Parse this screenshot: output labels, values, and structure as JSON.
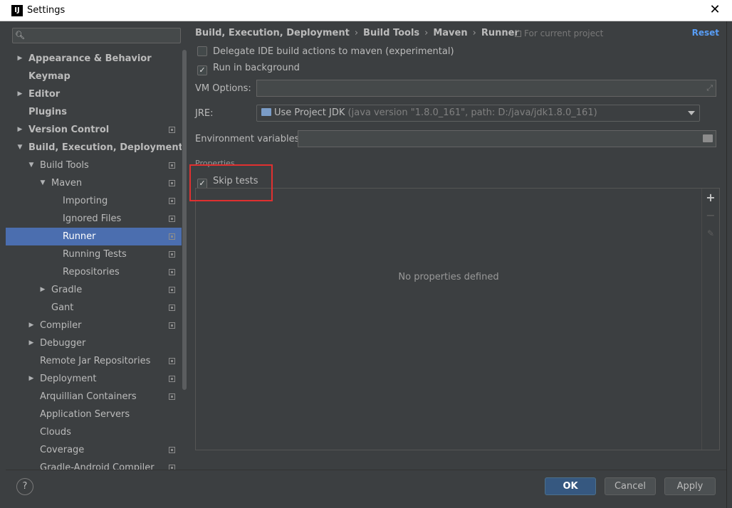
{
  "window": {
    "title": "Settings",
    "logo": "IJ"
  },
  "search": {
    "placeholder": ""
  },
  "tree": [
    {
      "label": "Appearance & Behavior",
      "level": 0,
      "arrow": "right",
      "bold": true,
      "proj": false
    },
    {
      "label": "Keymap",
      "level": 0,
      "arrow": "none",
      "bold": true,
      "proj": false
    },
    {
      "label": "Editor",
      "level": 0,
      "arrow": "right",
      "bold": true,
      "proj": false
    },
    {
      "label": "Plugins",
      "level": 0,
      "arrow": "none",
      "bold": true,
      "proj": false
    },
    {
      "label": "Version Control",
      "level": 0,
      "arrow": "right",
      "bold": true,
      "proj": true
    },
    {
      "label": "Build, Execution, Deployment",
      "level": 0,
      "arrow": "down",
      "bold": true,
      "proj": false
    },
    {
      "label": "Build Tools",
      "level": 1,
      "arrow": "down",
      "bold": false,
      "proj": true
    },
    {
      "label": "Maven",
      "level": 2,
      "arrow": "down",
      "bold": false,
      "proj": true
    },
    {
      "label": "Importing",
      "level": 3,
      "arrow": "none",
      "bold": false,
      "proj": true
    },
    {
      "label": "Ignored Files",
      "level": 3,
      "arrow": "none",
      "bold": false,
      "proj": true
    },
    {
      "label": "Runner",
      "level": 3,
      "arrow": "none",
      "bold": false,
      "proj": true,
      "selected": true
    },
    {
      "label": "Running Tests",
      "level": 3,
      "arrow": "none",
      "bold": false,
      "proj": true
    },
    {
      "label": "Repositories",
      "level": 3,
      "arrow": "none",
      "bold": false,
      "proj": true
    },
    {
      "label": "Gradle",
      "level": 2,
      "arrow": "right",
      "bold": false,
      "proj": true
    },
    {
      "label": "Gant",
      "level": 2,
      "arrow": "none",
      "bold": false,
      "proj": true
    },
    {
      "label": "Compiler",
      "level": 1,
      "arrow": "right",
      "bold": false,
      "proj": true
    },
    {
      "label": "Debugger",
      "level": 1,
      "arrow": "right",
      "bold": false,
      "proj": false
    },
    {
      "label": "Remote Jar Repositories",
      "level": 1,
      "arrow": "none",
      "bold": false,
      "proj": true
    },
    {
      "label": "Deployment",
      "level": 1,
      "arrow": "right",
      "bold": false,
      "proj": true
    },
    {
      "label": "Arquillian Containers",
      "level": 1,
      "arrow": "none",
      "bold": false,
      "proj": true
    },
    {
      "label": "Application Servers",
      "level": 1,
      "arrow": "none",
      "bold": false,
      "proj": false
    },
    {
      "label": "Clouds",
      "level": 1,
      "arrow": "none",
      "bold": false,
      "proj": false
    },
    {
      "label": "Coverage",
      "level": 1,
      "arrow": "none",
      "bold": false,
      "proj": true
    },
    {
      "label": "Gradle-Android Compiler",
      "level": 1,
      "arrow": "none",
      "bold": false,
      "proj": true
    }
  ],
  "breadcrumb": [
    "Build, Execution, Deployment",
    "Build Tools",
    "Maven",
    "Runner"
  ],
  "for_project": "For current project",
  "reset": "Reset",
  "options": {
    "delegate": {
      "label": "Delegate IDE build actions to maven (experimental)",
      "checked": false
    },
    "background": {
      "label": "Run in background",
      "checked": true
    }
  },
  "vm_options": {
    "label": "VM Options:",
    "value": ""
  },
  "jre": {
    "label": "JRE:",
    "value": "Use Project JDK",
    "detail": "(java version \"1.8.0_161\", path: D:/java/jdk1.8.0_161)"
  },
  "env": {
    "label": "Environment variables:",
    "value": ""
  },
  "properties": {
    "section": "Properties",
    "skip_tests": {
      "label": "Skip tests",
      "checked": true
    },
    "empty": "No properties defined"
  },
  "buttons": {
    "ok": "OK",
    "cancel": "Cancel",
    "apply": "Apply",
    "help": "?"
  }
}
